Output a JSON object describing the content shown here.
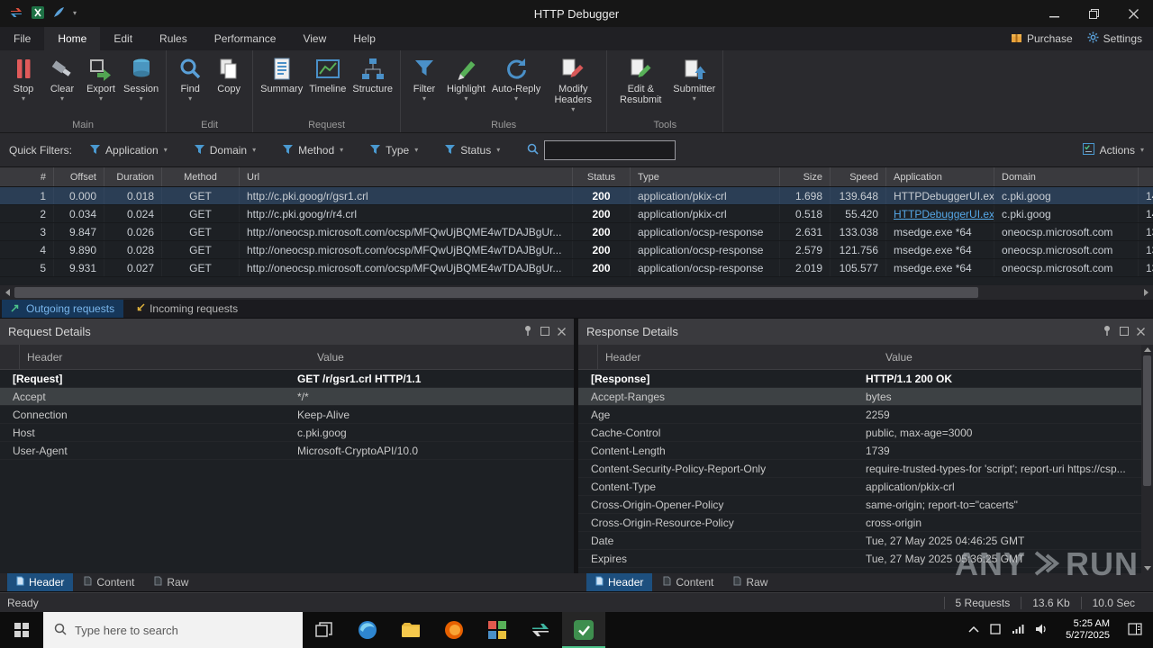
{
  "titlebar": {
    "title": "HTTP Debugger"
  },
  "menu": {
    "items": [
      "File",
      "Home",
      "Edit",
      "Rules",
      "Performance",
      "View",
      "Help"
    ],
    "purchase": "Purchase",
    "settings": "Settings"
  },
  "ribbon": {
    "buttons": {
      "stop": "Stop",
      "clear": "Clear",
      "export": "Export",
      "session": "Session",
      "find": "Find",
      "copy": "Copy",
      "summary": "Summary",
      "timeline": "Timeline",
      "structure": "Structure",
      "filter": "Filter",
      "highlight": "Highlight",
      "autoreply": "Auto-Reply",
      "modify_headers": "Modify Headers",
      "edit_resubmit": "Edit & Resubmit",
      "submitter": "Submitter"
    },
    "groups": {
      "main": "Main",
      "edit": "Edit",
      "request": "Request",
      "rules": "Rules",
      "tools": "Tools"
    }
  },
  "filters": {
    "label": "Quick Filters:",
    "application": "Application",
    "domain": "Domain",
    "method": "Method",
    "type": "Type",
    "status": "Status",
    "actions": "Actions",
    "search_value": ""
  },
  "grid": {
    "columns": [
      "#",
      "Offset",
      "Duration",
      "Method",
      "Url",
      "Status",
      "Type",
      "Size",
      "Speed",
      "Application",
      "Domain"
    ],
    "rows": [
      {
        "num": "1",
        "offset": "0.000",
        "duration": "0.018",
        "method": "GET",
        "url": "http://c.pki.goog/r/gsr1.crl",
        "status": "200",
        "type": "application/pkix-crl",
        "size": "1.698",
        "speed": "139.648",
        "application": "HTTPDebuggerUI.ex...",
        "domain": "c.pki.goog",
        "ip": "14"
      },
      {
        "num": "2",
        "offset": "0.034",
        "duration": "0.024",
        "method": "GET",
        "url": "http://c.pki.goog/r/r4.crl",
        "status": "200",
        "type": "application/pkix-crl",
        "size": "0.518",
        "speed": "55.420",
        "application": "HTTPDebuggerUI.ex...",
        "domain": "c.pki.goog",
        "ip": "14"
      },
      {
        "num": "3",
        "offset": "9.847",
        "duration": "0.026",
        "method": "GET",
        "url": "http://oneocsp.microsoft.com/ocsp/MFQwUjBQME4wTDAJBgUr...",
        "status": "200",
        "type": "application/ocsp-response",
        "size": "2.631",
        "speed": "133.038",
        "application": "msedge.exe *64",
        "domain": "oneocsp.microsoft.com",
        "ip": "13"
      },
      {
        "num": "4",
        "offset": "9.890",
        "duration": "0.028",
        "method": "GET",
        "url": "http://oneocsp.microsoft.com/ocsp/MFQwUjBQME4wTDAJBgUr...",
        "status": "200",
        "type": "application/ocsp-response",
        "size": "2.579",
        "speed": "121.756",
        "application": "msedge.exe *64",
        "domain": "oneocsp.microsoft.com",
        "ip": "13"
      },
      {
        "num": "5",
        "offset": "9.931",
        "duration": "0.027",
        "method": "GET",
        "url": "http://oneocsp.microsoft.com/ocsp/MFQwUjBQME4wTDAJBgUr...",
        "status": "200",
        "type": "application/ocsp-response",
        "size": "2.019",
        "speed": "105.577",
        "application": "msedge.exe *64",
        "domain": "oneocsp.microsoft.com",
        "ip": "13"
      }
    ]
  },
  "tabs": {
    "outgoing": "Outgoing requests",
    "incoming": "Incoming requests"
  },
  "request_panel": {
    "title": "Request Details",
    "col_header": "Header",
    "col_value": "Value",
    "rows": [
      {
        "h": "[Request]",
        "v": "GET /r/gsr1.crl HTTP/1.1"
      },
      {
        "h": "Accept",
        "v": "*/*"
      },
      {
        "h": "Connection",
        "v": "Keep-Alive"
      },
      {
        "h": "Host",
        "v": "c.pki.goog"
      },
      {
        "h": "User-Agent",
        "v": "Microsoft-CryptoAPI/10.0"
      }
    ],
    "tabs": [
      "Header",
      "Content",
      "Raw"
    ]
  },
  "response_panel": {
    "title": "Response Details",
    "col_header": "Header",
    "col_value": "Value",
    "rows": [
      {
        "h": "[Response]",
        "v": "HTTP/1.1 200 OK"
      },
      {
        "h": "Accept-Ranges",
        "v": "bytes"
      },
      {
        "h": "Age",
        "v": "2259"
      },
      {
        "h": "Cache-Control",
        "v": "public, max-age=3000"
      },
      {
        "h": "Content-Length",
        "v": "1739"
      },
      {
        "h": "Content-Security-Policy-Report-Only",
        "v": "require-trusted-types-for 'script'; report-uri https://csp..."
      },
      {
        "h": "Content-Type",
        "v": "application/pkix-crl"
      },
      {
        "h": "Cross-Origin-Opener-Policy",
        "v": "same-origin; report-to=\"cacerts\""
      },
      {
        "h": "Cross-Origin-Resource-Policy",
        "v": "cross-origin"
      },
      {
        "h": "Date",
        "v": "Tue, 27 May 2025 04:46:25 GMT"
      },
      {
        "h": "Expires",
        "v": "Tue, 27 May 2025 05:36:25 GMT"
      }
    ],
    "tabs": [
      "Header",
      "Content",
      "Raw"
    ]
  },
  "statusbar": {
    "ready": "Ready",
    "requests": "5 Requests",
    "size": "13.6 Kb",
    "time": "10.0 Sec"
  },
  "taskbar": {
    "search_placeholder": "Type here to search",
    "time": "5:25 AM",
    "date": "5/27/2025"
  },
  "watermark": {
    "left": "ANY",
    "right": "RUN"
  }
}
